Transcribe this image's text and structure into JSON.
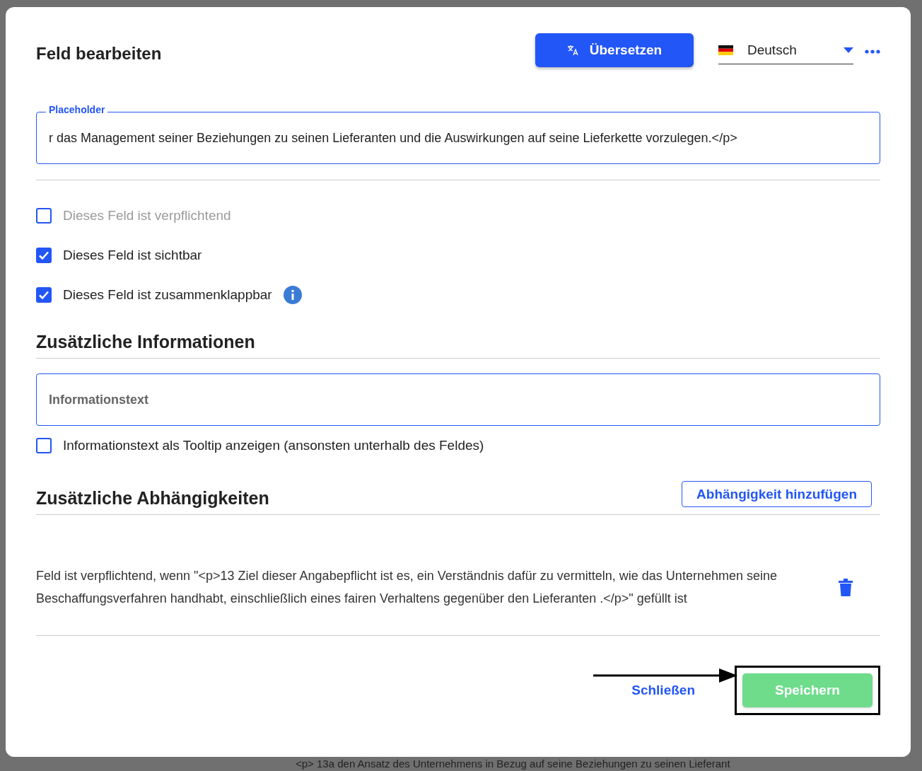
{
  "dialog": {
    "title": "Feld bearbeiten",
    "translate_button": "Übersetzen",
    "language": {
      "value": "Deutsch"
    }
  },
  "placeholder_field": {
    "label": "Placeholder",
    "value": "r das Management seiner Beziehungen zu seinen Lieferanten und die Auswirkungen auf seine Lieferkette vorzulegen.</p>"
  },
  "checkboxes": [
    {
      "label": "Dieses Feld ist verpflichtend",
      "checked": false,
      "disabled": true,
      "info": false
    },
    {
      "label": "Dieses Feld ist sichtbar",
      "checked": true,
      "disabled": false,
      "info": false
    },
    {
      "label": "Dieses Feld ist zusammenklappbar",
      "checked": true,
      "disabled": false,
      "info": true
    }
  ],
  "additional_info": {
    "heading": "Zusätzliche Informationen",
    "info_field": {
      "placeholder": "Informationstext"
    },
    "tooltip_checkbox": {
      "label": "Informationstext als Tooltip anzeigen (ansonsten unterhalb des Feldes)",
      "checked": false
    }
  },
  "dependencies": {
    "heading": "Zusätzliche Abhängigkeiten",
    "add_button": "Abhängigkeit hinzufügen",
    "items": [
      {
        "text": "Feld ist verpflichtend, wenn \"<p>13 Ziel dieser Angabepflicht ist es, ein Verständnis dafür zu vermitteln, wie das Unternehmen seine Beschaffungsverfahren handhabt, einschließlich eines fairen Verhaltens gegenüber den Lieferanten .</p>\" gefüllt ist"
      }
    ]
  },
  "footer": {
    "close_button": "Schließen",
    "save_button": "Speichern",
    "save_disabled": true,
    "highlight": true
  },
  "background": {
    "text": "<p> 13a den Ansatz des Unternehmens in Bezug auf seine Beziehungen zu seinen Lieferant"
  }
}
